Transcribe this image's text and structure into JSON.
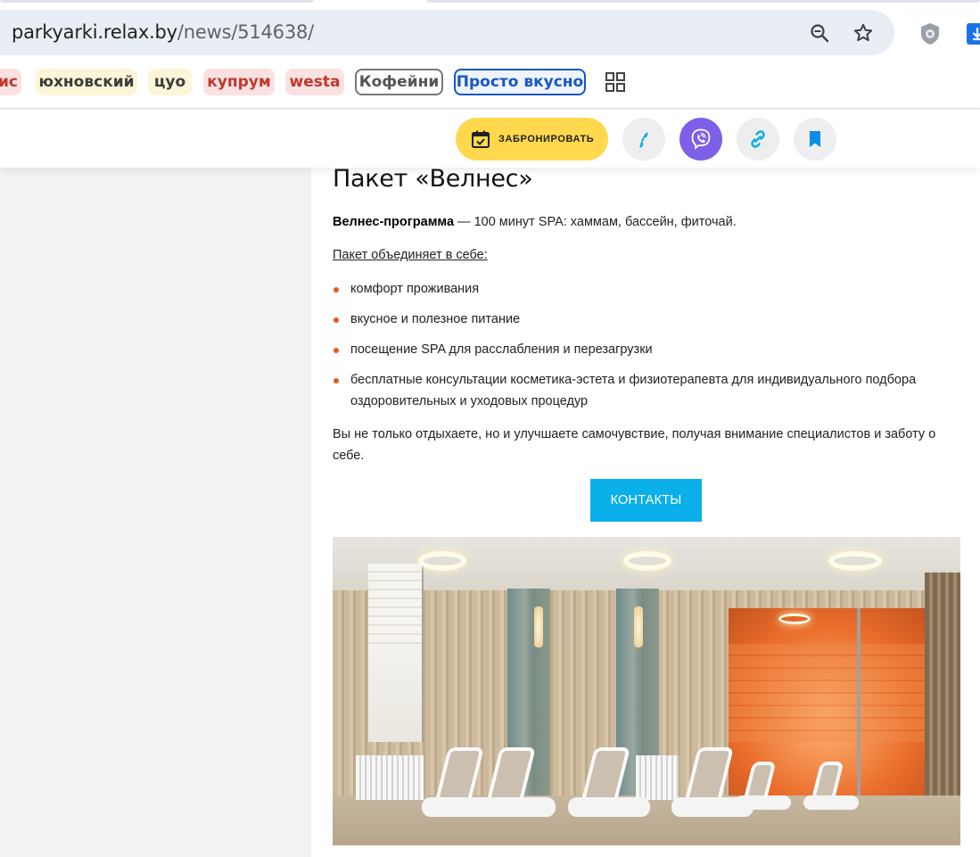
{
  "browser": {
    "url_host": "parkyarki.relax.by",
    "url_path": "/news/514638/",
    "bookmarks": [
      {
        "label": "ис",
        "style": "red"
      },
      {
        "label": "юхновский",
        "style": "yellow"
      },
      {
        "label": "цуо",
        "style": "yellow"
      },
      {
        "label": "купрум",
        "style": "red"
      },
      {
        "label": "westa",
        "style": "red"
      },
      {
        "label": "Кофейни",
        "style": "gray"
      },
      {
        "label": "Просто вкусно",
        "style": "blue"
      }
    ],
    "icons": [
      "zoom-out-icon",
      "star-icon",
      "shield-extension-icon",
      "download-icon",
      "apps-grid-icon"
    ]
  },
  "header": {
    "book_label": "ЗАБРОНИРОВАТЬ",
    "icons": [
      "calendar-check-icon",
      "phone-icon",
      "viber-icon",
      "link-icon",
      "bookmark-icon"
    ],
    "colors": {
      "book_bg": "#ffd84d",
      "viber": "#7d5fe8",
      "accent_blue": "#0bb0ea"
    }
  },
  "article": {
    "title": "Пакет «Велнес»",
    "intro_bold": "Велнес-программа",
    "intro_rest": " — 100 минут SPA: хаммам, бассейн, фиточай.",
    "list_heading": "Пакет объединяет в себе:",
    "items": [
      "комфорт проживания",
      "вкусное и полезное питание",
      "посещение SPA для расслабления и перезагрузки",
      "бесплатные консультации косметика-эстета и физиотерапевта для индивидуального подбора оздоровительных и уходовых процедур"
    ],
    "closing": "Вы не только отдыхаете, но и улучшаете самочувствие, получая внимание специалистов и заботу о себе.",
    "contacts_label": "КОНТАКТЫ",
    "bullet_color": "#e85a1b"
  }
}
